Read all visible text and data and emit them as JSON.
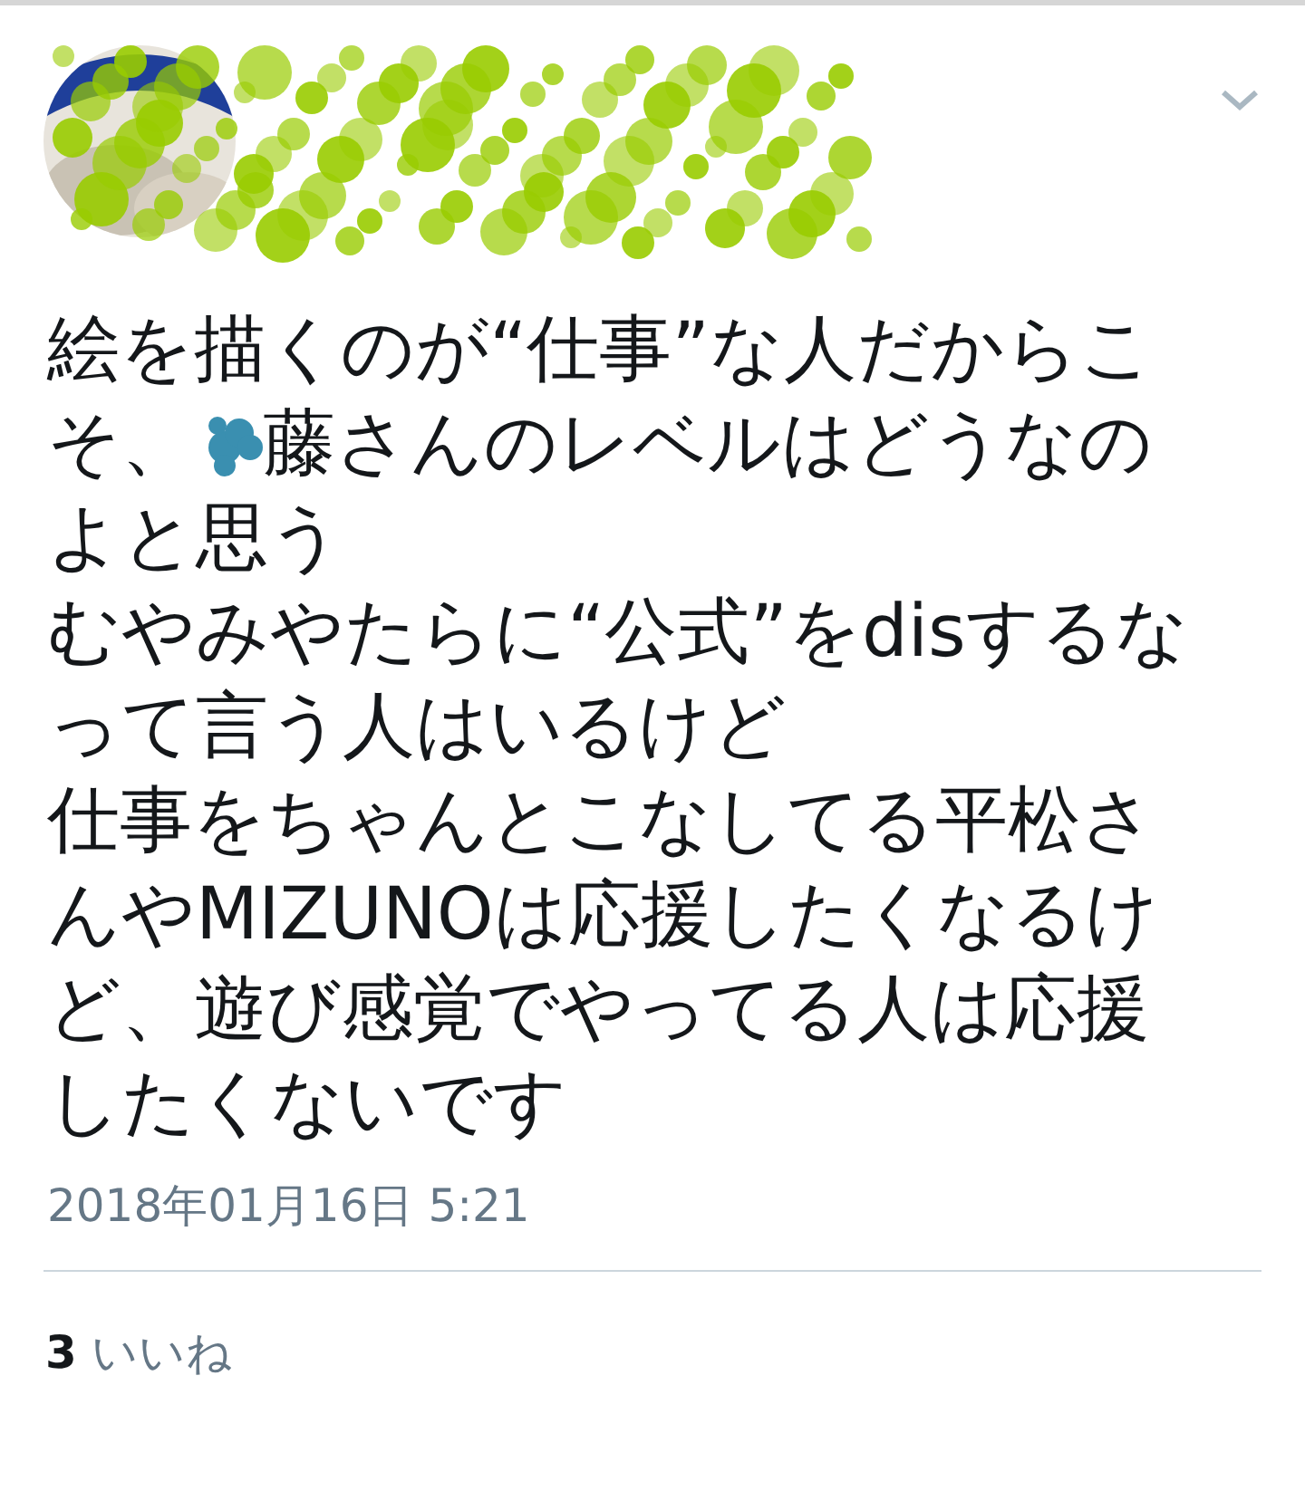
{
  "tweet": {
    "lines": [
      [
        {
          "kind": "text",
          "text": "絵を描くのが“仕事”な人だからこ"
        }
      ],
      [
        {
          "kind": "text",
          "text": "そ、"
        },
        {
          "kind": "redaction"
        },
        {
          "kind": "text",
          "text": "藤さんのレベルはどうなの"
        }
      ],
      [
        {
          "kind": "text",
          "text": "よと思う"
        }
      ],
      [
        {
          "kind": "text",
          "text": "むやみやたらに“公式”をdisするな"
        }
      ],
      [
        {
          "kind": "text",
          "text": "って言う人はいるけど"
        }
      ],
      [
        {
          "kind": "text",
          "text": "仕事をちゃんとこなしてる平松さ"
        }
      ],
      [
        {
          "kind": "text",
          "text": "んやMIZUNOは応援したくなるけ"
        }
      ],
      [
        {
          "kind": "text",
          "text": "ど、遊び感覚でやってる人は応援"
        }
      ],
      [
        {
          "kind": "text",
          "text": "したくないです"
        }
      ]
    ],
    "timestamp": "2018年01月16日 5:21",
    "likes": {
      "count": "3",
      "label": "いいね"
    }
  }
}
